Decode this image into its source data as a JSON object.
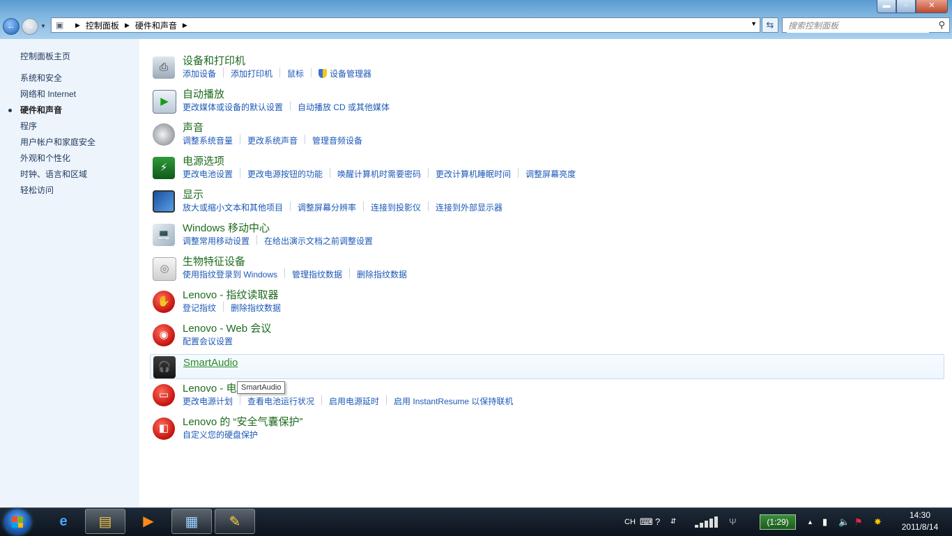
{
  "window": {
    "minimize_glyph": "▬",
    "maximize_glyph": "▫",
    "close_glyph": "✕"
  },
  "address": {
    "crumbs": [
      "控制面板",
      "硬件和声音"
    ],
    "search_placeholder": "搜索控制面板"
  },
  "left_pane": {
    "home": "控制面板主页",
    "items": [
      {
        "label": "系统和安全"
      },
      {
        "label": "网络和 Internet"
      },
      {
        "label": "硬件和声音",
        "active": true
      },
      {
        "label": "程序"
      },
      {
        "label": "用户帐户和家庭安全"
      },
      {
        "label": "外观和个性化"
      },
      {
        "label": "时钟、语言和区域"
      },
      {
        "label": "轻松访问"
      }
    ]
  },
  "categories": [
    {
      "title": "设备和打印机",
      "icon": "printer-icon",
      "links": [
        "添加设备",
        "添加打印机",
        "鼠标",
        "设备管理器"
      ]
    },
    {
      "title": "自动播放",
      "icon": "autoplay-icon",
      "links": [
        "更改媒体或设备的默认设置",
        "自动播放 CD 或其他媒体"
      ]
    },
    {
      "title": "声音",
      "icon": "speaker-icon",
      "links": [
        "调整系统音量",
        "更改系统声音",
        "管理音频设备"
      ]
    },
    {
      "title": "电源选项",
      "icon": "power-battery-icon",
      "links": [
        "更改电池设置",
        "更改电源按钮的功能",
        "唤醒计算机时需要密码",
        "更改计算机睡眠时间",
        "调整屏幕亮度"
      ]
    },
    {
      "title": "显示",
      "icon": "monitor-icon",
      "links": [
        "放大或缩小文本和其他项目",
        "调整屏幕分辨率",
        "连接到投影仪",
        "连接到外部显示器"
      ]
    },
    {
      "title": "Windows 移动中心",
      "icon": "laptop-icon",
      "links": [
        "调整常用移动设置",
        "在给出演示文档之前调整设置"
      ]
    },
    {
      "title": "生物特征设备",
      "icon": "fingerprint-icon",
      "links": [
        "使用指纹登录到 Windows",
        "管理指纹数据",
        "删除指纹数据"
      ]
    },
    {
      "title": "Lenovo - 指纹读取器",
      "icon": "lenovo-fingerprint-icon",
      "links": [
        "登记指纹",
        "删除指纹数据"
      ]
    },
    {
      "title": "Lenovo - Web 会议",
      "icon": "lenovo-webcam-icon",
      "links": [
        "配置会议设置"
      ]
    },
    {
      "title": "SmartAudio",
      "icon": "headphones-icon",
      "links": []
    },
    {
      "title": "Lenovo - 电",
      "icon": "lenovo-battery-icon",
      "links": [
        "更改电源计划",
        "查看电池运行状况",
        "启用电源延时",
        "启用 InstantResume 以保持联机"
      ]
    },
    {
      "title": "Lenovo 的 “安全气囊保护”",
      "icon": "lenovo-airbag-icon",
      "links": [
        "自定义您的硬盘保护"
      ]
    }
  ],
  "tooltip": "SmartAudio",
  "taskbar": {
    "lang": "CH",
    "battery_time": "(1:29)",
    "time": "14:30",
    "date": "2011/8/14"
  }
}
